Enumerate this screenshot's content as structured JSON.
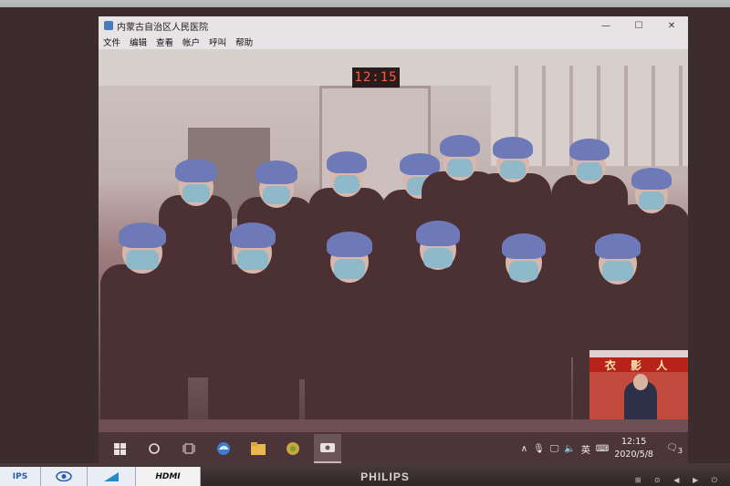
{
  "window": {
    "title": "内蒙古自治区人民医院",
    "controls": {
      "minimize": "—",
      "maximize": "☐",
      "close": "✕"
    }
  },
  "menu": [
    "文件",
    "编辑",
    "查看",
    "帐户",
    "呼叫",
    "帮助"
  ],
  "wall_clock": "12:15",
  "pip_banner": "衣 影 人",
  "taskbar": {
    "icons": [
      "windows-start-icon",
      "search-icon",
      "task-view-icon",
      "edge-icon",
      "file-explorer-icon",
      "app-icon",
      "video-call-icon"
    ],
    "tray": {
      "chevron": "∧",
      "language": "英",
      "time": "12:15",
      "date": "2020/5/8",
      "notifications": "3"
    }
  },
  "monitor": {
    "brand": "PHILIPS"
  },
  "stickers": [
    "IPS",
    "",
    "",
    "HDMI"
  ]
}
